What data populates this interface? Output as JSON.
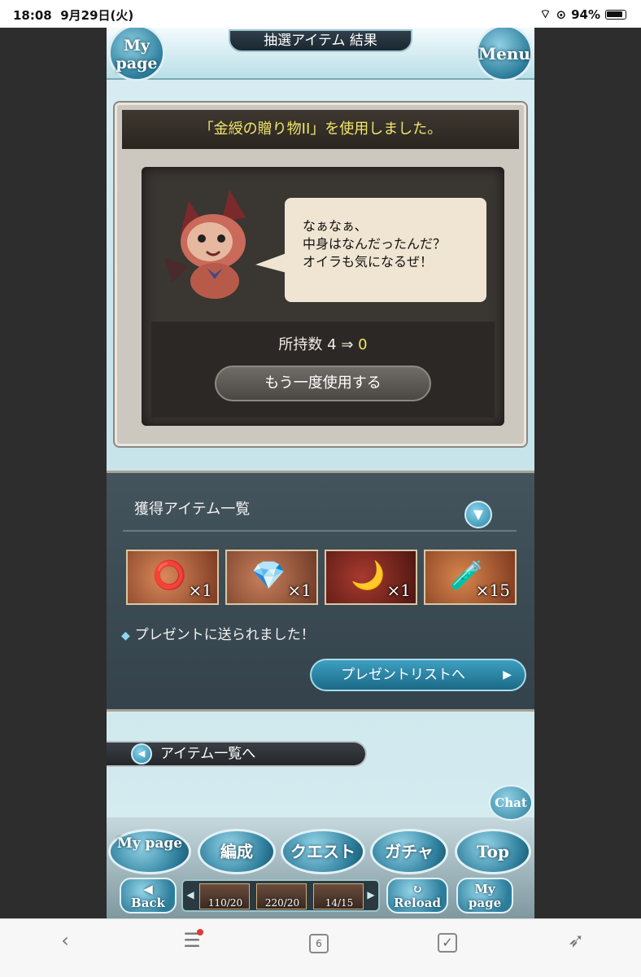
{
  "status_bar": {
    "time": "18:08",
    "date": "9月29日(火)",
    "battery": "94%"
  },
  "header": {
    "title": "抽選アイテム 結果",
    "mypage_label": "My page",
    "menu_label": "Menu"
  },
  "result": {
    "used_message": "「金綬の贈り物II」を使用しました。",
    "speech": [
      "なぁなぁ、",
      "中身はなんだったんだ？",
      "オイラも気になるぜ！"
    ],
    "count_label": "所持数",
    "count_before": "4",
    "count_arrow": "⇒",
    "count_after": "0",
    "use_again_label": "もう一度使用する"
  },
  "obtained": {
    "title": "獲得アイテム一覧",
    "items": [
      {
        "icon": "ring-icon",
        "glyph": "⭕",
        "qty": "×1"
      },
      {
        "icon": "earrings-icon",
        "glyph": "💎",
        "qty": "×1"
      },
      {
        "icon": "crescent-moon-icon",
        "glyph": "🌙",
        "qty": "×1"
      },
      {
        "icon": "potion-icon",
        "glyph": "🧪",
        "qty": "×15"
      }
    ],
    "sent_message": "プレゼントに送られました！",
    "present_list_label": "プレゼントリストへ"
  },
  "back_to_items_label": "アイテム一覧へ",
  "nav": {
    "chat": "Chat",
    "mypage": "My page",
    "hensei": "編成",
    "quest": "クエスト",
    "gacha": "ガチャ",
    "top": "Top",
    "back": "Back",
    "reload": "Reload",
    "mypage_small": "My page",
    "stamina": [
      "110/20",
      "220/20",
      "14/15"
    ]
  },
  "browser_toolbar": {
    "tab_count": "6"
  }
}
